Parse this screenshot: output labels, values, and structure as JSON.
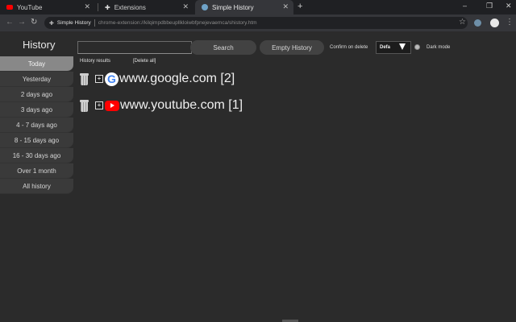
{
  "browser": {
    "tabs": [
      {
        "title": "YouTube",
        "icon": "youtube-icon"
      },
      {
        "title": "Extensions",
        "icon": "puzzle-icon"
      },
      {
        "title": "Simple History",
        "icon": "globe-icon",
        "active": true
      }
    ],
    "new_tab_symbol": "+",
    "site_chip": "Simple History",
    "url": "chrome-extension://kilqimpdbbeupllkloiwbfpnejevaemca/shistory.htm"
  },
  "page": {
    "title": "History",
    "search_placeholder": "",
    "search_label": "Search",
    "empty_label": "Empty History",
    "confirm_label": "Confirm on delete",
    "confirm_value": "Defa",
    "dark_mode_label": "Dark mode"
  },
  "sidebar": {
    "items": [
      {
        "label": "Today",
        "active": true
      },
      {
        "label": "Yesterday"
      },
      {
        "label": "2 days ago"
      },
      {
        "label": "3 days ago"
      },
      {
        "label": "4 - 7 days ago"
      },
      {
        "label": "8 - 15 days ago"
      },
      {
        "label": "16 - 30 days ago"
      },
      {
        "label": "Over 1 month"
      },
      {
        "label": "All history"
      }
    ]
  },
  "results": {
    "heading": "History results",
    "delete_all": "[Delete all]",
    "rows": [
      {
        "domain": "www.google.com [2]",
        "icon": "google-icon"
      },
      {
        "domain": "www.youtube.com [1]",
        "icon": "youtube-icon"
      }
    ]
  },
  "colors": {
    "background": "#2b2b2b",
    "active_sidebar": "#888888",
    "tab_bar": "#1f2023",
    "toolbar": "#35363a"
  }
}
